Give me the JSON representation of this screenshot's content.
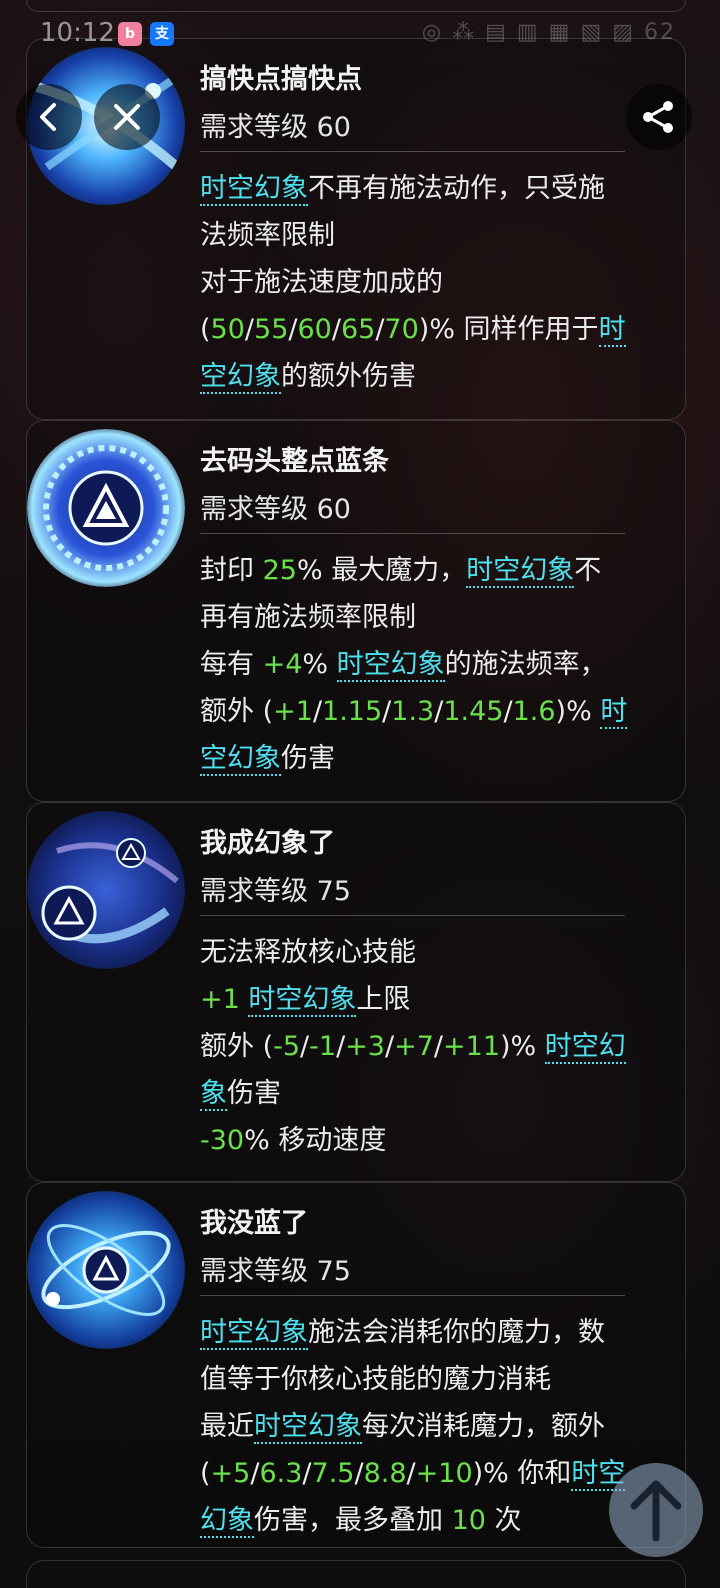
{
  "status_bar": {
    "time": "10:12",
    "apps": [
      "bilibili",
      "alipay"
    ],
    "right": "◎ ⁂ ▤ ▥ ▦ ▧ ▨ 62"
  },
  "nav": {
    "back_icon": "chevron-left-icon",
    "close_icon": "close-icon",
    "share_icon": "share-icon",
    "scroll_top_icon": "arrow-up-icon"
  },
  "keyword": "时空幻象",
  "cards": [
    {
      "title": "搞快点搞快点",
      "level": "需求等级 60",
      "lines": [
        [
          {
            "t": "时空幻象",
            "k": "kw"
          },
          {
            "t": "不再有施法动作，只受施"
          }
        ],
        [
          {
            "t": "法频率限制"
          }
        ],
        [
          {
            "t": "对于施法速度加成的"
          }
        ],
        [
          {
            "t": "("
          },
          {
            "t": "50",
            "k": "num"
          },
          {
            "t": "/"
          },
          {
            "t": "55",
            "k": "num"
          },
          {
            "t": "/"
          },
          {
            "t": "60",
            "k": "num"
          },
          {
            "t": "/"
          },
          {
            "t": "65",
            "k": "num"
          },
          {
            "t": "/"
          },
          {
            "t": "70",
            "k": "num"
          },
          {
            "t": ")% 同样作用于"
          },
          {
            "t": "时",
            "k": "kw"
          }
        ],
        [
          {
            "t": "空幻象",
            "k": "kw"
          },
          {
            "t": "的额外伤害"
          }
        ]
      ]
    },
    {
      "title": "去码头整点蓝条",
      "level": "需求等级 60",
      "lines": [
        [
          {
            "t": "封印 "
          },
          {
            "t": "25",
            "k": "num"
          },
          {
            "t": "% 最大魔力，"
          },
          {
            "t": "时空幻象",
            "k": "kw"
          },
          {
            "t": "不"
          }
        ],
        [
          {
            "t": "再有施法频率限制"
          }
        ],
        [
          {
            "t": "每有 "
          },
          {
            "t": "+4",
            "k": "num"
          },
          {
            "t": "% "
          },
          {
            "t": "时空幻象",
            "k": "kw"
          },
          {
            "t": "的施法频率，"
          }
        ],
        [
          {
            "t": "额外 ("
          },
          {
            "t": "+1",
            "k": "num"
          },
          {
            "t": "/"
          },
          {
            "t": "1.15",
            "k": "num"
          },
          {
            "t": "/"
          },
          {
            "t": "1.3",
            "k": "num"
          },
          {
            "t": "/"
          },
          {
            "t": "1.45",
            "k": "num"
          },
          {
            "t": "/"
          },
          {
            "t": "1.6",
            "k": "num"
          },
          {
            "t": ")% "
          },
          {
            "t": "时",
            "k": "kw"
          }
        ],
        [
          {
            "t": "空幻象",
            "k": "kw"
          },
          {
            "t": "伤害"
          }
        ]
      ]
    },
    {
      "title": "我成幻象了",
      "level": "需求等级 75",
      "lines": [
        [
          {
            "t": "无法释放核心技能"
          }
        ],
        [
          {
            "t": "+1",
            "k": "num"
          },
          {
            "t": " "
          },
          {
            "t": "时空幻象",
            "k": "kw"
          },
          {
            "t": "上限"
          }
        ],
        [
          {
            "t": "额外 ("
          },
          {
            "t": "-5",
            "k": "num"
          },
          {
            "t": "/"
          },
          {
            "t": "-1",
            "k": "num"
          },
          {
            "t": "/"
          },
          {
            "t": "+3",
            "k": "num"
          },
          {
            "t": "/"
          },
          {
            "t": "+7",
            "k": "num"
          },
          {
            "t": "/"
          },
          {
            "t": "+11",
            "k": "num"
          },
          {
            "t": ")% "
          },
          {
            "t": "时空幻",
            "k": "kw"
          }
        ],
        [
          {
            "t": "象",
            "k": "kw"
          },
          {
            "t": "伤害"
          }
        ],
        [
          {
            "t": "-30",
            "k": "num"
          },
          {
            "t": "% 移动速度"
          }
        ]
      ]
    },
    {
      "title": "我没蓝了",
      "level": "需求等级 75",
      "lines": [
        [
          {
            "t": "时空幻象",
            "k": "kw"
          },
          {
            "t": "施法会消耗你的魔力，数"
          }
        ],
        [
          {
            "t": "值等于你核心技能的魔力消耗"
          }
        ],
        [
          {
            "t": "最近"
          },
          {
            "t": "时空幻象",
            "k": "kw"
          },
          {
            "t": "每次消耗魔力，额外"
          }
        ],
        [
          {
            "t": "("
          },
          {
            "t": "+5",
            "k": "num"
          },
          {
            "t": "/"
          },
          {
            "t": "6.3",
            "k": "num"
          },
          {
            "t": "/"
          },
          {
            "t": "7.5",
            "k": "num"
          },
          {
            "t": "/"
          },
          {
            "t": "8.8",
            "k": "num"
          },
          {
            "t": "/"
          },
          {
            "t": "+10",
            "k": "num"
          },
          {
            "t": ")% 你和"
          },
          {
            "t": "时空",
            "k": "kw"
          }
        ],
        [
          {
            "t": "幻象",
            "k": "kw"
          },
          {
            "t": "伤害，最多叠加 "
          },
          {
            "t": "10",
            "k": "num"
          },
          {
            "t": " 次"
          }
        ]
      ]
    }
  ],
  "colors": {
    "keyword": "#4ee0ee",
    "number": "#6be04a",
    "text": "#ececec"
  }
}
